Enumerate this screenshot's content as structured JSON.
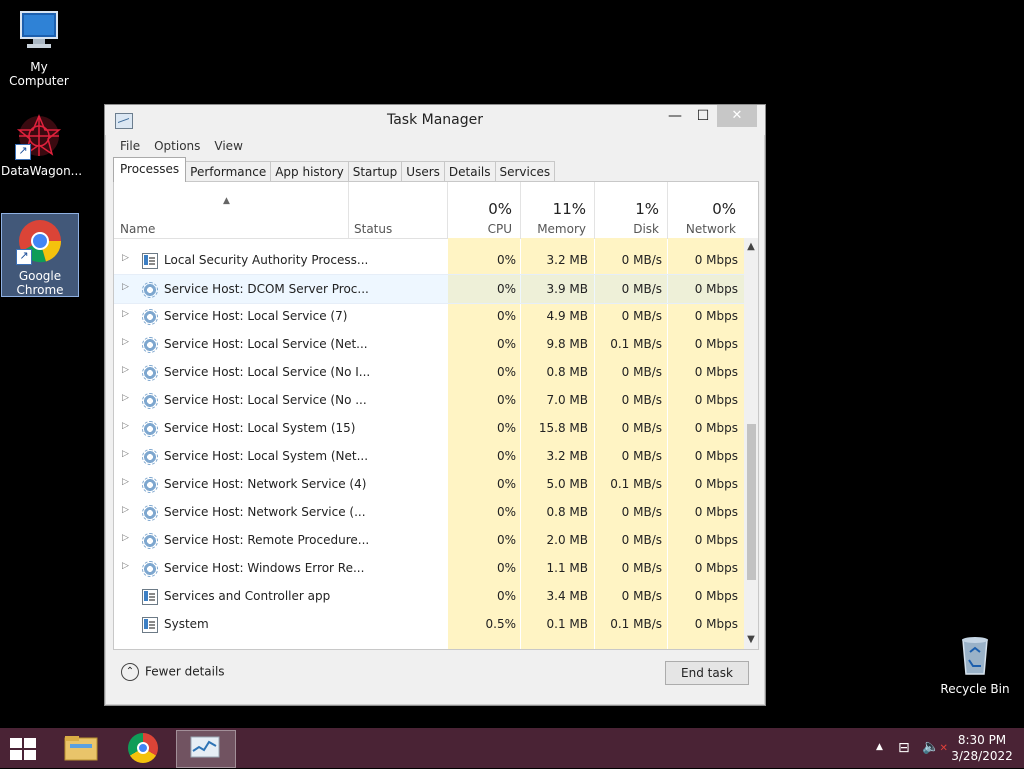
{
  "desktop": {
    "icons": [
      {
        "label": "My Computer",
        "icon": "computer-icon"
      },
      {
        "label": "DataWagon...",
        "icon": "datawagon-icon"
      },
      {
        "label": "Google Chrome",
        "icon": "chrome-icon"
      },
      {
        "label": "Recycle Bin",
        "icon": "recycle-bin-icon"
      }
    ]
  },
  "window": {
    "title": "Task Manager",
    "menu": [
      "File",
      "Options",
      "View"
    ],
    "tabs": [
      "Processes",
      "Performance",
      "App history",
      "Startup",
      "Users",
      "Details",
      "Services"
    ],
    "columns": {
      "name": "Name",
      "status": "Status",
      "cpu": {
        "pct": "0%",
        "label": "CPU"
      },
      "memory": {
        "pct": "11%",
        "label": "Memory"
      },
      "disk": {
        "pct": "1%",
        "label": "Disk"
      },
      "network": {
        "pct": "0%",
        "label": "Network"
      }
    },
    "rows": [
      {
        "name": "Local Security Authority Process...",
        "cpu": "0%",
        "memory": "3.2 MB",
        "disk": "0 MB/s",
        "network": "0 Mbps",
        "expandable": true,
        "icon": "box"
      },
      {
        "name": "Service Host: DCOM Server Proc...",
        "cpu": "0%",
        "memory": "3.9 MB",
        "disk": "0 MB/s",
        "network": "0 Mbps",
        "expandable": true,
        "icon": "gear"
      },
      {
        "name": "Service Host: Local Service (7)",
        "cpu": "0%",
        "memory": "4.9 MB",
        "disk": "0 MB/s",
        "network": "0 Mbps",
        "expandable": true,
        "icon": "gear"
      },
      {
        "name": "Service Host: Local Service (Net...",
        "cpu": "0%",
        "memory": "9.8 MB",
        "disk": "0.1 MB/s",
        "network": "0 Mbps",
        "expandable": true,
        "icon": "gear"
      },
      {
        "name": "Service Host: Local Service (No I...",
        "cpu": "0%",
        "memory": "0.8 MB",
        "disk": "0 MB/s",
        "network": "0 Mbps",
        "expandable": true,
        "icon": "gear"
      },
      {
        "name": "Service Host: Local Service (No ...",
        "cpu": "0%",
        "memory": "7.0 MB",
        "disk": "0 MB/s",
        "network": "0 Mbps",
        "expandable": true,
        "icon": "gear"
      },
      {
        "name": "Service Host: Local System (15)",
        "cpu": "0%",
        "memory": "15.8 MB",
        "disk": "0 MB/s",
        "network": "0 Mbps",
        "expandable": true,
        "icon": "gear"
      },
      {
        "name": "Service Host: Local System (Net...",
        "cpu": "0%",
        "memory": "3.2 MB",
        "disk": "0 MB/s",
        "network": "0 Mbps",
        "expandable": true,
        "icon": "gear"
      },
      {
        "name": "Service Host: Network Service (4)",
        "cpu": "0%",
        "memory": "5.0 MB",
        "disk": "0.1 MB/s",
        "network": "0 Mbps",
        "expandable": true,
        "icon": "gear"
      },
      {
        "name": "Service Host: Network Service (...",
        "cpu": "0%",
        "memory": "0.8 MB",
        "disk": "0 MB/s",
        "network": "0 Mbps",
        "expandable": true,
        "icon": "gear"
      },
      {
        "name": "Service Host: Remote Procedure...",
        "cpu": "0%",
        "memory": "2.0 MB",
        "disk": "0 MB/s",
        "network": "0 Mbps",
        "expandable": true,
        "icon": "gear"
      },
      {
        "name": "Service Host: Windows Error Re...",
        "cpu": "0%",
        "memory": "1.1 MB",
        "disk": "0 MB/s",
        "network": "0 Mbps",
        "expandable": true,
        "icon": "gear"
      },
      {
        "name": "Services and Controller app",
        "cpu": "0%",
        "memory": "3.4 MB",
        "disk": "0 MB/s",
        "network": "0 Mbps",
        "expandable": false,
        "icon": "box"
      },
      {
        "name": "System",
        "cpu": "0.5%",
        "memory": "0.1 MB",
        "disk": "0.1 MB/s",
        "network": "0 Mbps",
        "expandable": false,
        "icon": "box"
      }
    ],
    "footer": {
      "fewer_details": "Fewer details",
      "end_task": "End task"
    }
  },
  "taskbar": {
    "items": [
      "file-explorer-icon",
      "chrome-icon",
      "task-manager-icon"
    ],
    "time": "8:30 PM",
    "date": "3/28/2022"
  }
}
